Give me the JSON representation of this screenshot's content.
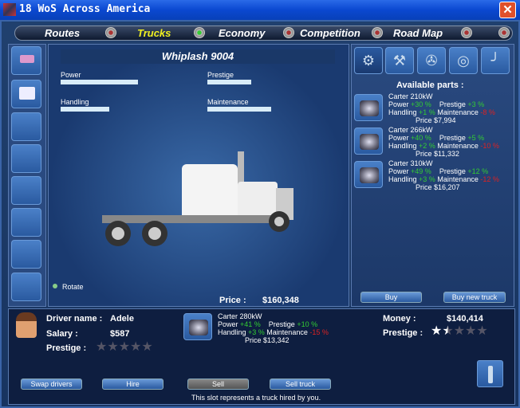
{
  "window": {
    "title": "18 WoS Across America",
    "close": "✕"
  },
  "tabs": [
    {
      "label": "Routes",
      "active": false
    },
    {
      "label": "Trucks",
      "active": true
    },
    {
      "label": "Economy",
      "active": false
    },
    {
      "label": "Competition",
      "active": false
    },
    {
      "label": "Road Map",
      "active": false
    }
  ],
  "truck": {
    "name": "Whiplash 9004",
    "stats": [
      {
        "label": "Power",
        "value": 0.97
      },
      {
        "label": "Prestige",
        "value": 0.55
      },
      {
        "label": "Handling",
        "value": 0.61
      },
      {
        "label": "Maintenance",
        "value": 0.8
      }
    ],
    "rotate_label": "Rotate",
    "price_label": "Price :",
    "price": "$160,348"
  },
  "part_types": [
    "engine",
    "transmission",
    "chassis",
    "tires",
    "exhaust"
  ],
  "parts": {
    "title": "Available parts :",
    "items": [
      {
        "name": "Carter 210kW",
        "power": "+30 %",
        "prestige": "+3 %",
        "handling": "+1 %",
        "maintenance": "-8 %",
        "price": "Price $7,994"
      },
      {
        "name": "Carter 266kW",
        "power": "+40 %",
        "prestige": "+5 %",
        "handling": "+2 %",
        "maintenance": "-10 %",
        "price": "Price $11,332"
      },
      {
        "name": "Carter 310kW",
        "power": "+49 %",
        "prestige": "+12 %",
        "handling": "+3 %",
        "maintenance": "-12 %",
        "price": "Price $16,207"
      }
    ],
    "labels": {
      "power": "Power",
      "prestige": "Prestige",
      "handling": "Handling",
      "maintenance": "Maintenance"
    },
    "buy": "Buy",
    "buy_new": "Buy new truck"
  },
  "driver": {
    "name_label": "Driver name :",
    "name": "Adele",
    "salary_label": "Salary :",
    "salary": "$587",
    "prestige_label": "Prestige :",
    "prestige_stars": 0
  },
  "current_part": {
    "name": "Carter 280kW",
    "power": "+41 %",
    "prestige": "+10 %",
    "handling": "+3 %",
    "maintenance": "-15 %",
    "price": "Price $13,342"
  },
  "company": {
    "money_label": "Money :",
    "money": "$140,414",
    "prestige_label": "Prestige :",
    "prestige_stars": 1.5
  },
  "buttons": {
    "swap": "Swap drivers",
    "hire": "Hire",
    "sell": "Sell",
    "sell_truck": "Sell truck"
  },
  "status": "This slot represents a truck hired by you."
}
